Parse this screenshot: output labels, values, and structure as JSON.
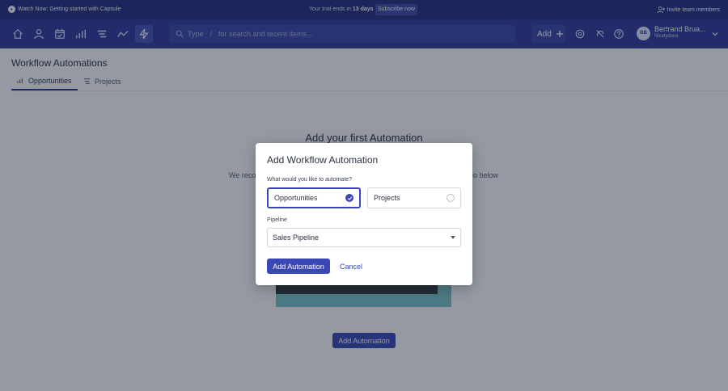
{
  "topbar": {
    "watch_text": "Watch Now: Getting started with Capsule",
    "trial_prefix": "Your trial ends in",
    "trial_days": "13 days",
    "subscribe_label": "Subscribe now",
    "invite_label": "Invite team members"
  },
  "nav": {
    "icons": [
      "home-icon",
      "contacts-icon",
      "calendar-icon",
      "pipeline-icon",
      "projects-icon",
      "analytics-icon",
      "automation-icon"
    ],
    "search_type": "Type",
    "search_slash": "/",
    "search_placeholder": "for search and recent items...",
    "add_label": "Add",
    "user_initials": "BB",
    "user_name": "Bertrand Brua...",
    "user_company": "Nicelydone"
  },
  "page": {
    "title": "Workflow Automations",
    "tabs": [
      {
        "label": "Opportunities",
        "icon": "bars-icon",
        "active": true
      },
      {
        "label": "Projects",
        "icon": "list-icon",
        "active": false
      }
    ]
  },
  "empty_state": {
    "title": "Add your first Automation",
    "text_left": "We recom",
    "text_right": "eo below",
    "button_label": "Add Automation"
  },
  "modal": {
    "title": "Add Workflow Automation",
    "question": "What would you like to automate?",
    "options": [
      {
        "label": "Opportunities",
        "selected": true
      },
      {
        "label": "Projects",
        "selected": false
      }
    ],
    "pipeline_label": "Pipeline",
    "pipeline_value": "Sales Pipeline",
    "primary_label": "Add Automation",
    "cancel_label": "Cancel"
  },
  "colors": {
    "topbar": "#242f80",
    "navbar": "#2e3a99",
    "accent": "#3a47b5"
  }
}
